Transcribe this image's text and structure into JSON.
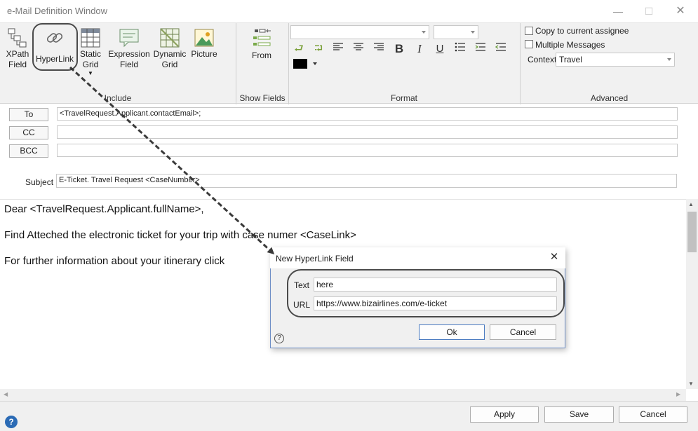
{
  "window": {
    "title": "e-Mail Definition Window"
  },
  "ribbon": {
    "include": {
      "title": "Include",
      "buttons": [
        {
          "id": "xpath",
          "label1": "XPath",
          "label2": "Field",
          "icon": "xpath-field-icon"
        },
        {
          "id": "hyperlink",
          "label1": "HyperLink",
          "label2": "",
          "icon": "hyperlink-icon"
        },
        {
          "id": "static",
          "label1": "Static",
          "label2": "Grid",
          "icon": "static-grid-icon"
        },
        {
          "id": "expression",
          "label1": "Expression",
          "label2": "Field",
          "icon": "expression-field-icon"
        },
        {
          "id": "dynamic",
          "label1": "Dynamic",
          "label2": "Grid",
          "icon": "dynamic-grid-icon"
        },
        {
          "id": "picture",
          "label1": "Picture",
          "label2": "",
          "icon": "picture-icon"
        }
      ]
    },
    "show_fields": {
      "title": "Show Fields",
      "from_label": "From"
    },
    "format": {
      "title": "Format",
      "font_value": "",
      "size_value": ""
    },
    "advanced": {
      "title": "Advanced",
      "copy_label": "Copy to current assignee",
      "multiple_label": "Multiple Messages",
      "context_label": "Context",
      "context_value": "Travel"
    }
  },
  "address": {
    "to_label": "To",
    "to_value": "<TravelRequest.Applicant.contactEmail>;",
    "cc_label": "CC",
    "cc_value": "",
    "bcc_label": "BCC",
    "bcc_value": "",
    "subject_label": "Subject",
    "subject_value": "E-Ticket. Travel Request <CaseNumber>"
  },
  "body": {
    "line1": "Dear <TravelRequest.Applicant.fullName>,",
    "line2": "Find Atteched the electronic ticket for your trip with case numer <CaseLink>",
    "line3": "For further information about your itinerary click"
  },
  "footer": {
    "apply": "Apply",
    "save": "Save",
    "cancel": "Cancel"
  },
  "dialog": {
    "title": "New HyperLink Field",
    "text_label": "Text",
    "text_value": "here",
    "url_label": "URL",
    "url_value": "https://www.bizairlines.com/e-ticket",
    "ok": "Ok",
    "cancel": "Cancel",
    "help": "?"
  },
  "colors": {
    "callout": "#4a4a4a",
    "accent": "#6d8ec6",
    "ribbon_bg": "#f1f1f1"
  }
}
